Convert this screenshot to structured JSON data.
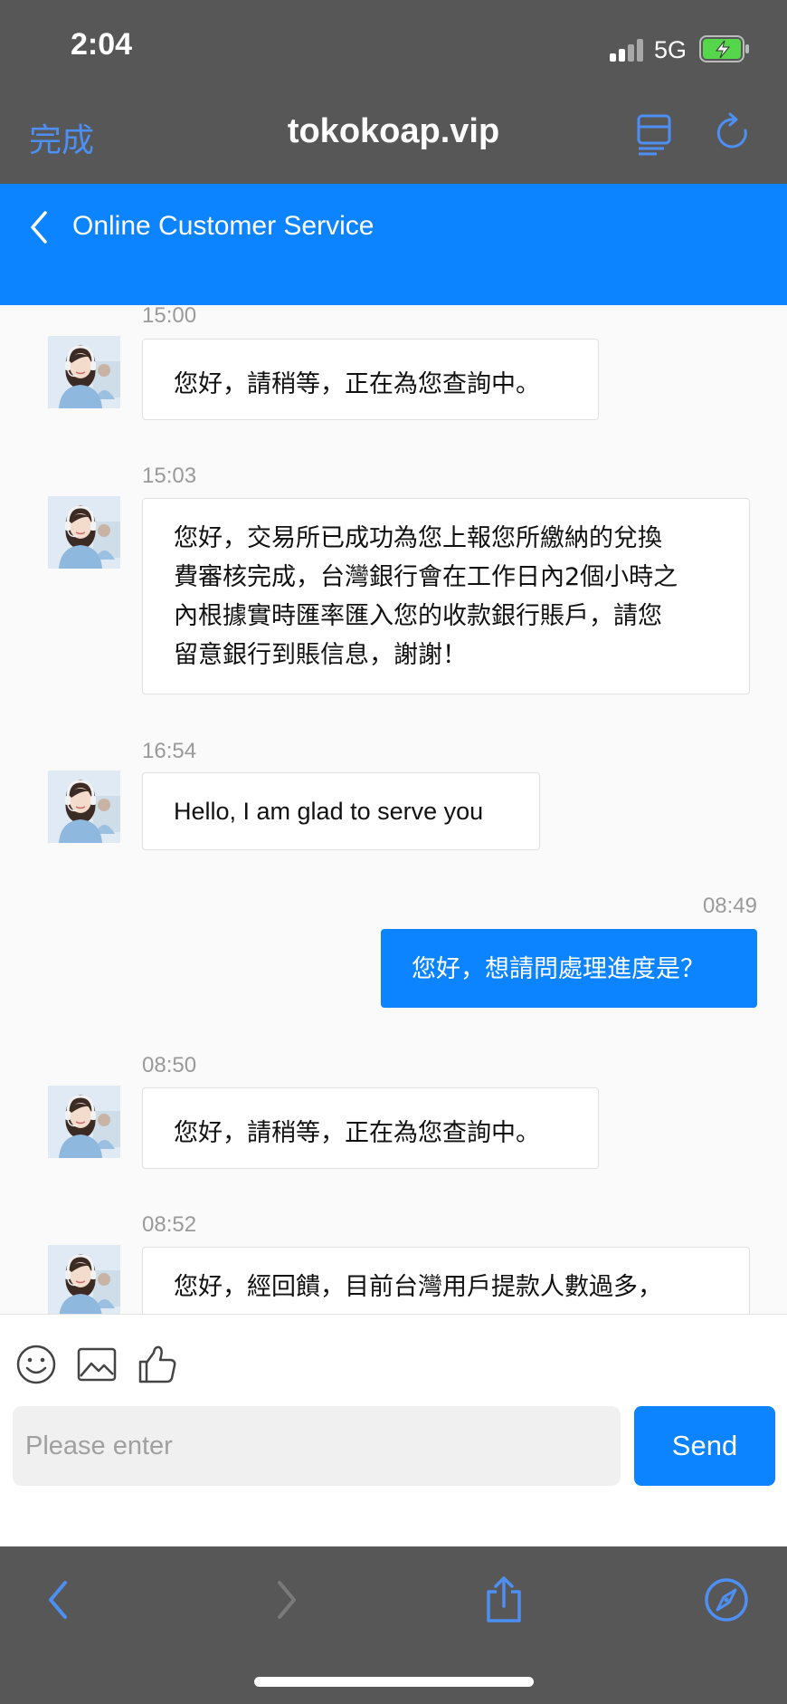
{
  "status_bar": {
    "time": "2:04",
    "network": "5G",
    "icons": [
      "signal-bars-icon",
      "battery-charging-icon"
    ]
  },
  "browser": {
    "done_label": "完成",
    "url": "tokokoap.vip",
    "accent_color": "#4d8ff2",
    "icons": [
      "reader-view-icon",
      "reload-icon",
      "back-icon",
      "forward-icon",
      "share-icon",
      "compass-icon"
    ]
  },
  "chat": {
    "header_title": "Online Customer Service",
    "header_color": "#0d84ff",
    "messages": [
      {
        "side": "left",
        "time": "15:00",
        "text": "您好，請稍等，正在為您查詢中。"
      },
      {
        "side": "left",
        "time": "15:03",
        "lines": [
          "您好，交易所已成功為您上報您所繳納的兌換",
          "費審核完成，台灣銀行會在工作日內2個小時之",
          "內根據實時匯率匯入您的收款銀行賬戶，請您",
          "留意銀行到賬信息，謝謝！"
        ]
      },
      {
        "side": "left",
        "time": "16:54",
        "text": "Hello, I am glad to serve you"
      },
      {
        "side": "right",
        "time": "08:49",
        "text": "您好，想請問處理進度是？"
      },
      {
        "side": "left",
        "time": "08:50",
        "text": "您好，請稍等，正在為您查詢中。"
      },
      {
        "side": "left",
        "time": "08:52",
        "text": "您好，經回饋，目前台灣用戶提款人數過多，"
      }
    ]
  },
  "composer": {
    "placeholder": "Please enter",
    "value": "",
    "send_label": "Send",
    "icons": [
      "emoji-icon",
      "image-icon",
      "thumbs-up-icon"
    ]
  }
}
